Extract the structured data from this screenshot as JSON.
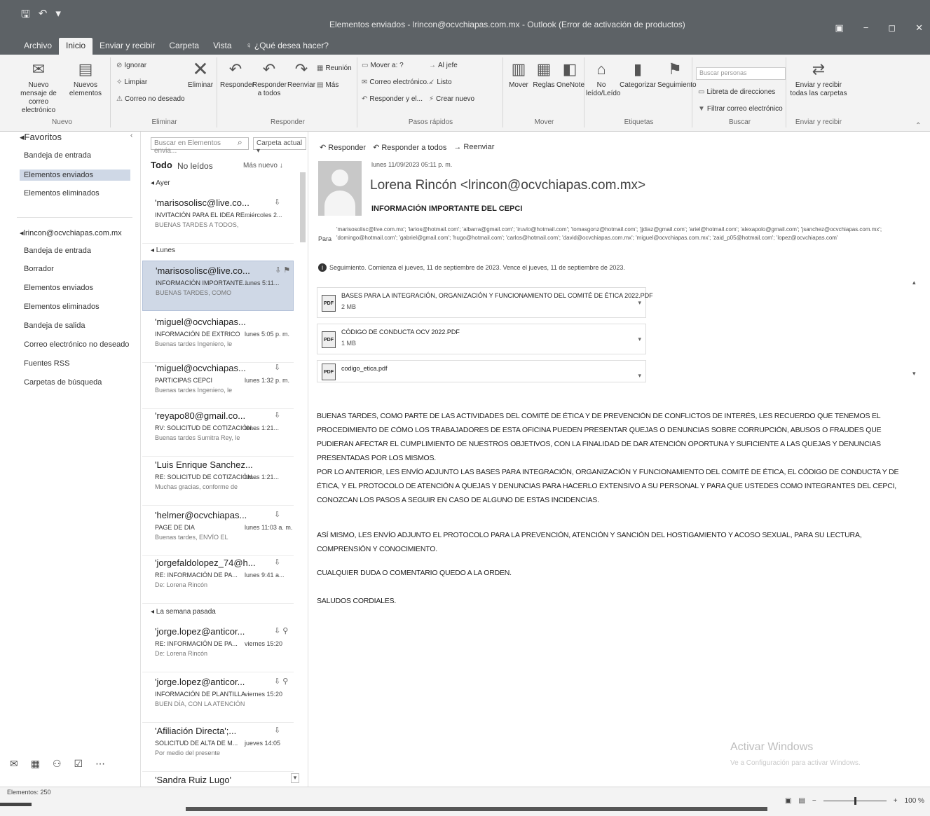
{
  "window": {
    "title": "Elementos enviados - lrincon@ocvchiapas.com.mx - Outlook (Error de activación de productos)",
    "qat": [
      "save-icon",
      "undo-icon",
      "customize-icon"
    ],
    "controls": [
      "ribbon-display-icon",
      "minimize-icon",
      "restore-icon",
      "close-icon"
    ]
  },
  "menu": {
    "tabs": [
      "Archivo",
      "Inicio",
      "Enviar y recibir",
      "Carpeta",
      "Vista",
      "♀ ¿Qué desea hacer?"
    ]
  },
  "ribbon": {
    "nuevo": {
      "label": "Nuevo",
      "new_email": "Nuevo mensaje de correo electrónico",
      "new_items": "Nuevos elementos"
    },
    "eliminar": {
      "label": "Eliminar",
      "ignore": "Ignorar",
      "cleanup": "Limpiar",
      "junk": "Correo no deseado",
      "delete": "Eliminar"
    },
    "responder": {
      "label": "Responder",
      "reply": "Responder",
      "reply_all": "Responder a todos",
      "forward": "Reenviar",
      "meeting": "Reunión",
      "more": "Más"
    },
    "pasos_rapidos": {
      "label": "Pasos rápidos",
      "items": [
        "Mover a: ?",
        "Correo electrónico...",
        "Responder y el...",
        "Al jefe",
        "Listo",
        "Crear nuevo"
      ]
    },
    "mover": {
      "label": "Mover",
      "move": "Mover",
      "rules": "Reglas",
      "onenote": "OneNote"
    },
    "etiquetas": {
      "label": "Etiquetas",
      "unread": "No leído/Leído",
      "categorize": "Categorizar",
      "followup": "Seguimiento"
    },
    "buscar": {
      "label": "Buscar",
      "search_people": "Buscar personas",
      "address_book": "Libreta de direcciones",
      "filter_email": "Filtrar correo electrónico"
    },
    "enviar_recibir": {
      "label": "Enviar y recibir",
      "send_receive_all": "Enviar y recibir todas las carpetas"
    }
  },
  "folders": {
    "favorites_header": "◂Favoritos",
    "favorites": [
      "Bandeja de entrada",
      "Elementos enviados",
      "Elementos eliminados"
    ],
    "selected_index": 1,
    "account_header": "◂lrincon@ocvchiapas.com.mx",
    "account_folders": [
      "Bandeja de entrada",
      "Borrador",
      "Elementos enviados",
      "Elementos eliminados",
      "Bandeja de salida",
      "Correo electrónico no deseado",
      "Fuentes RSS",
      "Carpetas de búsqueda"
    ],
    "nav_icons": [
      "mail-icon",
      "calendar-icon",
      "people-icon",
      "tasks-icon",
      "more-icon"
    ]
  },
  "msglist": {
    "search_placeholder": "Buscar en Elementos envia...",
    "scope": "Carpeta actual",
    "filter_all": "Todo",
    "filter_unread": "No leídos",
    "sort": "Más nuevo ↓",
    "groups": [
      "◂ Ayer",
      "◂ Lunes",
      "◂ La semana pasada"
    ],
    "messages": [
      {
        "from": "'marisosolisc@live.co...",
        "subj": "INVITACIÓN PARA EL IDEA RE...",
        "date": "miércoles 2...",
        "prev": "BUENAS TARDES A TODOS,",
        "flags": "⇩"
      },
      {
        "from": "'marisosolisc@live.co...",
        "subj": "INFORMACIÓN IMPORTANTE...",
        "date": "lunes 5:11...",
        "prev": "BUENAS TARDES, COMO",
        "flags": "⇩ ⚑"
      },
      {
        "from": "'miguel@ocvchiapas...",
        "subj": "INFORMACIÓN DE EXTRICO",
        "date": "lunes 5:05 p. m.",
        "prev": "Buenas tardes Ingeniero, le",
        "flags": ""
      },
      {
        "from": "'miguel@ocvchiapas...",
        "subj": "PARTICIPAS CEPCI",
        "date": "lunes 1:32 p. m.",
        "prev": "Buenas tardes Ingeniero, le",
        "flags": "⇩"
      },
      {
        "from": "'reyapo80@gmail.co...",
        "subj": "RV: Solicitud de cotización...",
        "date": "lunes 1:21...",
        "prev": "Buenas tardes Sumitra Rey, le",
        "flags": "⇩"
      },
      {
        "from": "'Luis Enrique Sanchez...",
        "subj": "RE: Solicitud de cotización...",
        "date": "lunes 1:21...",
        "prev": "Muchas gracias, conforme de",
        "flags": ""
      },
      {
        "from": "'helmer@ocvchiapas...",
        "subj": "PAGE DE DIA",
        "date": "lunes 11:03 a. m.",
        "prev": "Buenas tardes, ENVÍO EL",
        "flags": "⇩"
      },
      {
        "from": "'jorgefaldolopez_74@h...",
        "subj": "RE: INFORMACIÓN DE PA...",
        "date": "lunes 9:41 a...",
        "prev": "De: Lorena Rincón",
        "flags": "⇩"
      },
      {
        "from": "'jorge.lopez@anticor...",
        "subj": "RE: INFORMACIÓN DE PA...",
        "date": "viernes 15:20",
        "prev": "De: Lorena Rincón",
        "flags": "⇩ ⚲"
      },
      {
        "from": "'jorge.lopez@anticor...",
        "subj": "INFORMACIÓN DE PLANTILLA",
        "date": "viernes 15:20",
        "prev": "BUEN DÍA, CON LA ATENCIÓN",
        "flags": "⇩ ⚲"
      },
      {
        "from": "'Afiliación Directa';...",
        "subj": "SOLICITUD DE ALTA de M...",
        "date": "jueves 14:05",
        "prev": "Por medio del presente",
        "flags": "⇩"
      },
      {
        "from": "'Sandra Ruiz Lugo'",
        "subj": "",
        "date": "",
        "prev": "",
        "flags": ""
      }
    ]
  },
  "reading": {
    "actions": [
      "↶ Responder",
      "↶ Responder a todos",
      "→ Reenviar"
    ],
    "date": "lunes 11/09/2023 05:11 p. m.",
    "sender": "Lorena Rincón <lrincon@ocvchiapas.com.mx>",
    "subject": "INFORMACIÓN IMPORTANTE DEL CEPCI",
    "to_label": "Para",
    "to": "'marisosolisc@live.com.mx'; 'larios@hotmail.com'; 'albarra@gmail.com'; 'iruvlo@hotmail.com'; 'tomasgonz@hotmail.com'; 'jjdiaz@gmail.com'; 'ariel@hotmail.com'; 'alexapolo@gmail.com'; 'jsanchez@ocvchiapas.com.mx'; 'domingo@hotmail.com'; 'gabriel@gmail.com'; 'hugo@hotmail.com'; 'carlos@hotmail.com'; 'david@ocvchiapas.com.mx'; 'miguel@ocvchiapas.com.mx'; 'zaid_p05@hotmail.com'; 'lopez@ocvchiapas.com'",
    "follow_up": "Seguimiento.  Comienza el jueves, 11 de septiembre de 2023.  Vence el jueves, 11 de septiembre de 2023.",
    "attachments": [
      {
        "name": "BASES PARA LA INTEGRACIÓN, ORGANIZACIÓN Y FUNCIONAMIENTO DEL COMITÉ DE ÉTICA 2022.pdf",
        "size": "2 MB",
        "icon": "PDF"
      },
      {
        "name": "CÓDIGO DE CONDUCTA OCV 2022.pdf",
        "size": "1 MB",
        "icon": "PDF"
      },
      {
        "name": "codigo_etica.pdf",
        "size": "",
        "icon": "PDF"
      }
    ],
    "paragraphs": [
      "Buenas tardes, como parte de las actividades del Comité de Ética y de Prevención de Conflictos de Interés, les recuerdo que tenemos el procedimiento de cómo los trabajadores de esta oficina pueden presentar quejas o denuncias sobre corrupción, abusos o fraudes que pudieran afectar el cumplimiento de nuestros objetivos, con la finalidad de dar atención oportuna y suficiente a las quejas y denuncias presentadas por los mismos.",
      "Por lo anterior, les envío adjunto las bases para integración, organización y funcionamiento del comité de ética, el código de conducta y de ética, y el protocolo de atención a quejas y denuncias para hacerlo extensivo a su personal y para que ustedes como integrantes del CEPCI, conozcan los pasos a seguir en caso de alguno de estas incidencias.",
      "Así mismo, les envío adjunto el protocolo para la prevención, atención y sanción del hostigamiento y acoso sexual, para su lectura, comprensión y conocimiento.",
      "Cualquier duda o comentario quedo a la orden.",
      "Saludos cordiales."
    ],
    "watermark_title": "Activar Windows",
    "watermark_sub": "Ve a Configuración para activar Windows."
  },
  "status": {
    "items": "Elementos: 250",
    "zoom": "100 %"
  }
}
